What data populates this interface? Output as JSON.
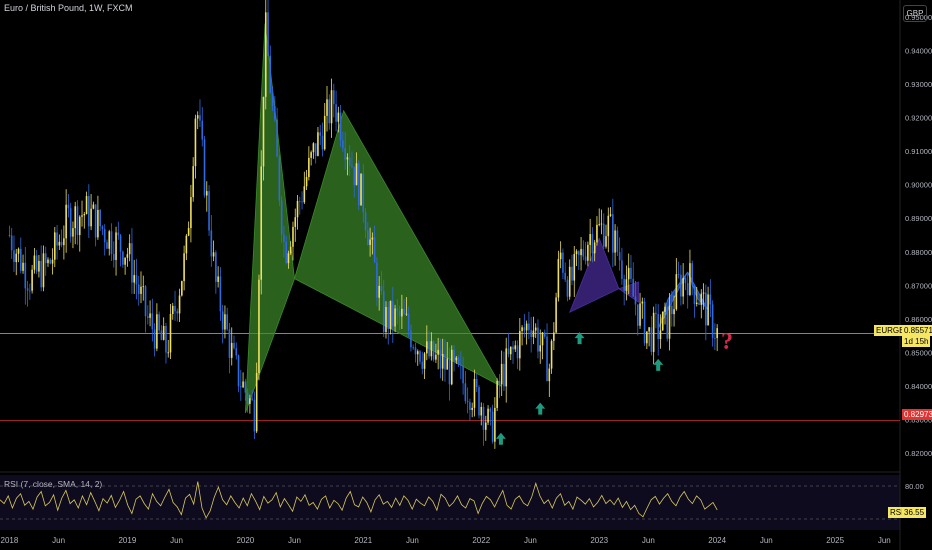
{
  "title": "Euro / British Pound, 1W, FXCM",
  "currency": "GBP",
  "chart_data": [
    {
      "type": "candlestick",
      "symbol": "EURGBP",
      "timeframe": "1W",
      "source": "FXCM",
      "ylim": [
        0.815,
        0.955
      ],
      "y_ticks": [
        "0.82000",
        "0.83000",
        "0.84000",
        "0.85000",
        "0.86000",
        "0.87000",
        "0.88000",
        "0.89000",
        "0.90000",
        "0.91000",
        "0.92000",
        "0.93000",
        "0.94000",
        "0.95000"
      ],
      "x_ticks": [
        "2018",
        "Jun",
        "2019",
        "Jun",
        "2020",
        "Jun",
        "2021",
        "Jun",
        "2022",
        "Jun",
        "2023",
        "Jun",
        "2024",
        "Jun",
        "2025",
        "Jun"
      ],
      "price_path": [
        [
          "2018-01",
          0.885
        ],
        [
          "2018-03",
          0.872
        ],
        [
          "2018-05",
          0.876
        ],
        [
          "2018-07",
          0.89
        ],
        [
          "2018-09",
          0.892
        ],
        [
          "2018-11",
          0.885
        ],
        [
          "2019-01",
          0.88
        ],
        [
          "2019-03",
          0.86
        ],
        [
          "2019-05",
          0.851
        ],
        [
          "2019-07",
          0.88
        ],
        [
          "2019-08",
          0.925
        ],
        [
          "2019-10",
          0.87
        ],
        [
          "2019-12",
          0.845
        ],
        [
          "2020-02",
          0.832
        ],
        [
          "2020-03",
          0.948
        ],
        [
          "2020-05",
          0.88
        ],
        [
          "2020-08",
          0.91
        ],
        [
          "2020-10",
          0.925
        ],
        [
          "2020-12",
          0.905
        ],
        [
          "2021-01",
          0.895
        ],
        [
          "2021-03",
          0.86
        ],
        [
          "2021-05",
          0.86
        ],
        [
          "2021-07",
          0.85
        ],
        [
          "2021-10",
          0.845
        ],
        [
          "2022-01",
          0.835
        ],
        [
          "2022-02",
          0.826
        ],
        [
          "2022-03",
          0.843
        ],
        [
          "2022-06",
          0.86
        ],
        [
          "2022-08",
          0.845
        ],
        [
          "2022-09",
          0.88
        ],
        [
          "2022-10",
          0.87
        ],
        [
          "2022-12",
          0.885
        ],
        [
          "2023-02",
          0.888
        ],
        [
          "2023-04",
          0.87
        ],
        [
          "2023-06",
          0.855
        ],
        [
          "2023-08",
          0.859
        ],
        [
          "2023-09",
          0.87
        ],
        [
          "2023-10",
          0.873
        ],
        [
          "2023-12",
          0.862
        ],
        [
          "2024-01",
          0.8557
        ]
      ],
      "last_price": "0.85571",
      "countdown": "1d 15h",
      "horizontal_levels": [
        {
          "price": 0.8557,
          "label": "0.85571",
          "color": "#f5e663"
        },
        {
          "price": 0.82973,
          "label": "0.82973",
          "color": "#e03333"
        }
      ],
      "patterns": [
        {
          "color": "#3b8a2a",
          "points": [
            [
              "2020-01",
              0.832
            ],
            [
              "2020-03",
              0.948
            ],
            [
              "2020-06",
              0.872
            ],
            [
              "2020-11",
              0.922
            ],
            [
              "2022-03",
              0.84
            ]
          ]
        },
        {
          "color": "#4b2ea0",
          "points": [
            [
              "2022-10",
              0.862
            ],
            [
              "2023-01",
              0.884
            ],
            [
              "2023-03",
              0.869
            ],
            [
              "2023-05",
              0.871
            ],
            [
              "2023-05",
              0.865
            ]
          ]
        },
        {
          "color": "#2f6ae0",
          "points": [
            [
              "2023-07",
              0.857
            ],
            [
              "2023-08",
              0.866
            ],
            [
              "2023-10",
              0.874
            ],
            [
              "2023-11",
              0.866
            ],
            [
              "2023-12",
              0.863
            ]
          ]
        }
      ],
      "arrows": [
        {
          "date": "2022-03",
          "price": 0.824
        },
        {
          "date": "2022-07",
          "price": 0.833
        },
        {
          "date": "2022-11",
          "price": 0.854
        },
        {
          "date": "2023-07",
          "price": 0.846
        }
      ],
      "question_mark": {
        "date": "2024-02",
        "price": 0.8535,
        "text": "?"
      }
    },
    {
      "type": "line",
      "title": "RSI (7, close, SMA, 14, 2)",
      "ylim": [
        0,
        100
      ],
      "y_ticks": [
        "80.00"
      ],
      "bands": [
        20,
        80
      ],
      "last_value": "36.55",
      "label": "RSI",
      "values": [
        55,
        48,
        62,
        40,
        58,
        66,
        45,
        52,
        38,
        60,
        70,
        44,
        50,
        64,
        36,
        58,
        72,
        48,
        55,
        40,
        62,
        46,
        68,
        52,
        35,
        57,
        49,
        63,
        41,
        54,
        70,
        45,
        30,
        56,
        62,
        48,
        38,
        66,
        52,
        44,
        60,
        74,
        50,
        42,
        28,
        58,
        65,
        47,
        88,
        40,
        22,
        35,
        60,
        78,
        55,
        46,
        62,
        50,
        40,
        58,
        44,
        66,
        53,
        37,
        61,
        49,
        55,
        68,
        42,
        57,
        46,
        34,
        60,
        52,
        64,
        45,
        50,
        38,
        56,
        62,
        40,
        54,
        48,
        36,
        58,
        70,
        46,
        42,
        60,
        50,
        33,
        55,
        64,
        47,
        52,
        41,
        58,
        45,
        62,
        54,
        38,
        56,
        49,
        44,
        60,
        52,
        36,
        65,
        58,
        43,
        50,
        62,
        46,
        40,
        57,
        53,
        30,
        48,
        61,
        55,
        42,
        58,
        72,
        45,
        38,
        56,
        62,
        49,
        44,
        60,
        85,
        62,
        48,
        55,
        40,
        58,
        66,
        45,
        52,
        38,
        60,
        54,
        47,
        57,
        42,
        50,
        63,
        48,
        55,
        46,
        58,
        41,
        52,
        37,
        45,
        30,
        24,
        40,
        55,
        61,
        47,
        58,
        66,
        52,
        44,
        60,
        70,
        56,
        48,
        62,
        55,
        38,
        44,
        50,
        36.55
      ]
    }
  ]
}
